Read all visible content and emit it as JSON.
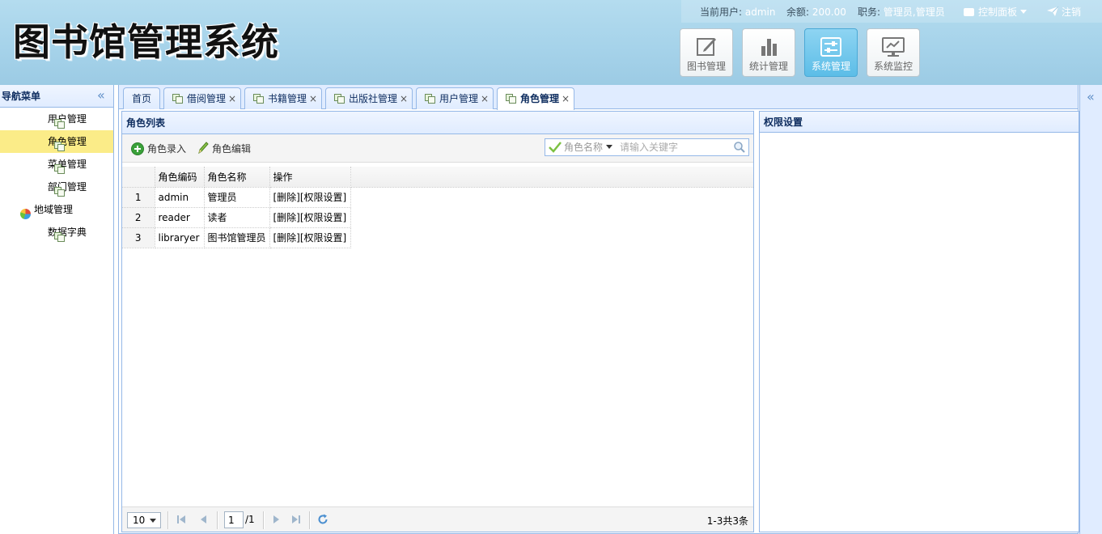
{
  "header": {
    "logo": "图书馆管理系统",
    "user_label": "当前用户:",
    "user_value": "admin",
    "balance_label": "余额:",
    "balance_value": "200.00",
    "role_label": "职务:",
    "role_value": "管理员,管理员",
    "control_panel": "控制面板",
    "logout": "注销",
    "modules": [
      {
        "label": "图书管理",
        "icon": "edit-icon",
        "active": false
      },
      {
        "label": "统计管理",
        "icon": "bar-chart-icon",
        "active": false
      },
      {
        "label": "系统管理",
        "icon": "settings-sliders-icon",
        "active": true
      },
      {
        "label": "系统监控",
        "icon": "monitor-icon",
        "active": false
      }
    ]
  },
  "sidebar": {
    "title": "导航菜单",
    "collapse": "«",
    "items": [
      {
        "label": "用户管理",
        "icon": "document-icon",
        "active": false
      },
      {
        "label": "角色管理",
        "icon": "document-icon",
        "active": true
      },
      {
        "label": "菜单管理",
        "icon": "document-icon",
        "active": false
      },
      {
        "label": "部门管理",
        "icon": "document-icon",
        "active": false
      },
      {
        "label": "地域管理",
        "icon": "globe-icon",
        "active": false
      },
      {
        "label": "数据字典",
        "icon": "document-icon",
        "active": false
      }
    ]
  },
  "east": {
    "collapse": "«"
  },
  "tabs": [
    {
      "label": "首页",
      "closable": false,
      "active": false
    },
    {
      "label": "借阅管理",
      "closable": true,
      "active": false
    },
    {
      "label": "书籍管理",
      "closable": true,
      "active": false
    },
    {
      "label": "出版社管理",
      "closable": true,
      "active": false
    },
    {
      "label": "用户管理",
      "closable": true,
      "active": false
    },
    {
      "label": "角色管理",
      "closable": true,
      "active": true
    }
  ],
  "tab_close": "×",
  "role_panel": {
    "title": "角色列表",
    "toolbar": {
      "add": "角色录入",
      "edit": "角色编辑"
    },
    "search": {
      "field": "角色名称",
      "placeholder": "请输入关键字"
    },
    "columns": [
      "角色编码",
      "角色名称",
      "操作"
    ],
    "rows": [
      {
        "num": "1",
        "code": "admin",
        "name": "管理员",
        "ops": "[删除][权限设置]"
      },
      {
        "num": "2",
        "code": "reader",
        "name": "读者",
        "ops": "[删除][权限设置]"
      },
      {
        "num": "3",
        "code": "libraryer",
        "name": "图书馆管理员",
        "ops": "[删除][权限设置]"
      }
    ],
    "pager": {
      "page_size": "10",
      "page": "1",
      "total_pages": "/1",
      "info": "1-3共3条"
    }
  },
  "perm_panel": {
    "title": "权限设置"
  },
  "colors": {
    "accent": "#95b8e7",
    "header": "#a6d3ea",
    "active_nav": "#fbec88",
    "module_active": "#5cbde7"
  }
}
